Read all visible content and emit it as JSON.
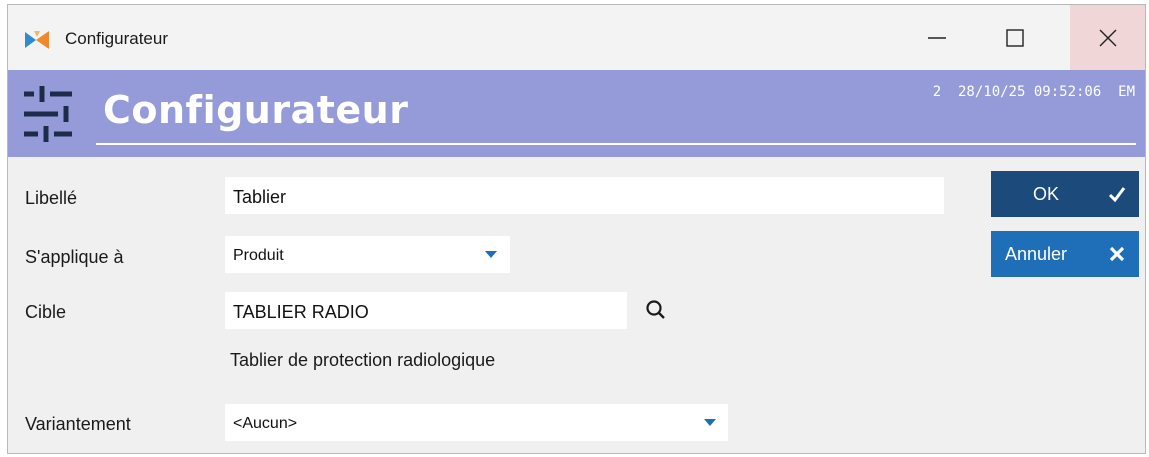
{
  "window": {
    "title": "Configurateur",
    "controls": [
      "minimize-icon",
      "maximize-icon",
      "close-icon"
    ]
  },
  "header": {
    "title": "Configurateur",
    "status": "2  28/10/25 09:52:06  EM",
    "background_color": "#949bd8",
    "icon": "sliders-icon"
  },
  "form": {
    "libelle": {
      "label": "Libellé",
      "value": "Tablier"
    },
    "applique": {
      "label": "S'applique à",
      "value": "Produit"
    },
    "cible": {
      "label": "Cible",
      "value": "TABLIER RADIO",
      "description": "Tablier de protection radiologique"
    },
    "variantement": {
      "label": "Variantement",
      "value": "<Aucun>"
    }
  },
  "buttons": {
    "ok": {
      "label": "OK",
      "color": "#1c4a7b",
      "icon": "check-icon"
    },
    "cancel": {
      "label": "Annuler",
      "color": "#1f6fb8",
      "icon": "close-icon"
    }
  },
  "colors": {
    "accent": "#1f6fb8",
    "close_hover": "#f1d6d7"
  }
}
